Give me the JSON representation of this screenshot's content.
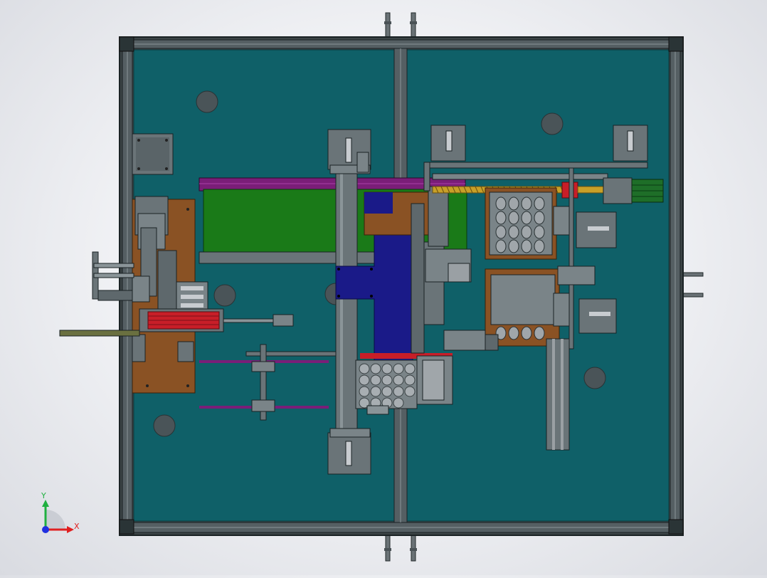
{
  "viewport": {
    "background": "#eceef2"
  },
  "model": {
    "plate_color": "#0f6068",
    "frame_color": "#3c4446",
    "edge_color": "#1a2224",
    "rail_color": "#5a6468",
    "brown_plate_color": "#8a5224",
    "green_panel_color": "#1a7a18",
    "purple_bar_color": "#7a1e78",
    "navy_block_color": "#1a1a88",
    "red_cylinder_color": "#c81e28",
    "motor_green": "#1e6e28",
    "screw_color": "#c8a028",
    "mount_color": "#6a7478",
    "hole_color": "#4a5458",
    "bracket_color": "#b8bcc0"
  },
  "triad": {
    "x_label": "X",
    "y_label": "Y",
    "x_color": "#e02020",
    "y_color": "#20b040",
    "z_color": "#2030e0"
  }
}
